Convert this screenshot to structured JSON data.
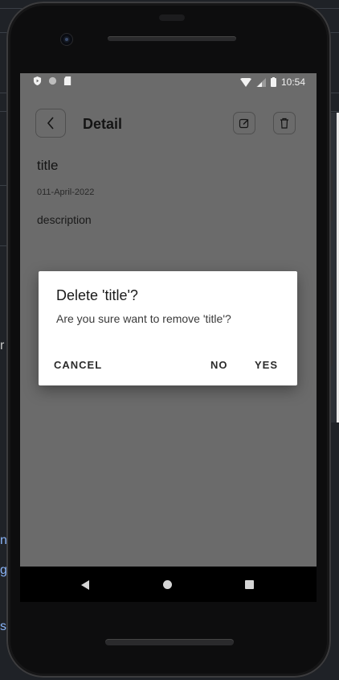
{
  "background": {
    "fragments": [
      "r",
      "nl",
      "g",
      "s"
    ]
  },
  "status_bar": {
    "time": "10:54"
  },
  "app_bar": {
    "title": "Detail"
  },
  "note": {
    "title": "title",
    "date": "011-April-2022",
    "description": "description"
  },
  "dialog": {
    "title": "Delete 'title'?",
    "message": "Are you sure want to remove 'title'?",
    "cancel_label": "CANCEL",
    "no_label": "NO",
    "yes_label": "YES"
  },
  "icons": {
    "status_left": [
      "play-protect-icon",
      "circle-status-icon",
      "sd-card-icon"
    ],
    "status_right": [
      "wifi-icon",
      "cell-signal-icon",
      "battery-icon"
    ],
    "back": "chevron-left-icon",
    "edit": "edit-icon",
    "delete": "trash-icon",
    "nav": [
      "nav-back-icon",
      "nav-home-icon",
      "nav-recents-icon"
    ]
  },
  "colors": {
    "scrim": "#6b6b6b",
    "dialog_bg": "#ffffff",
    "text": "#141414"
  }
}
